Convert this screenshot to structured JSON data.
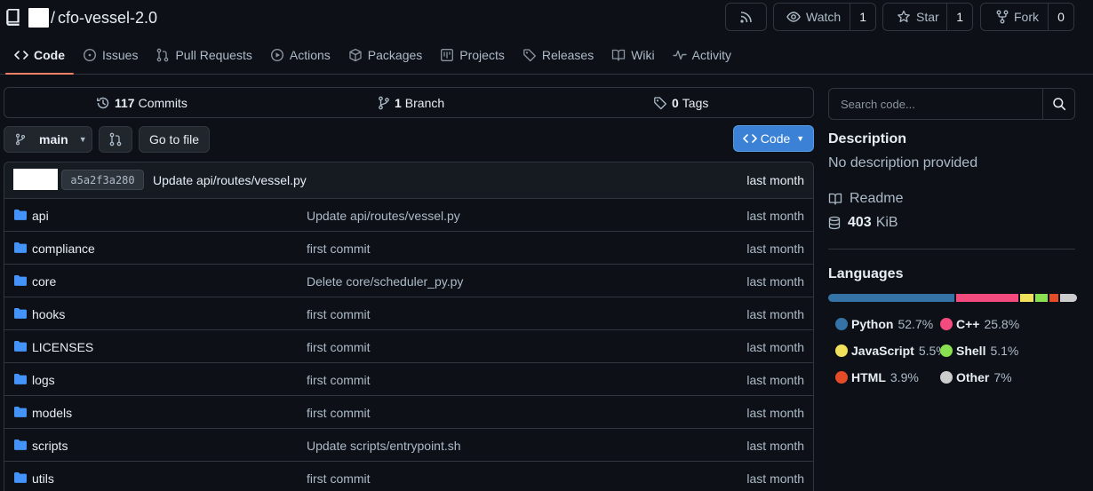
{
  "repo": {
    "separator": "/",
    "name": "cfo-vessel-2.0"
  },
  "header_actions": {
    "watch": {
      "label": "Watch",
      "count": "1"
    },
    "star": {
      "label": "Star",
      "count": "1"
    },
    "fork": {
      "label": "Fork",
      "count": "0"
    }
  },
  "tabs": [
    {
      "label": "Code",
      "icon": "code-icon",
      "active": true
    },
    {
      "label": "Issues",
      "icon": "issue-icon"
    },
    {
      "label": "Pull Requests",
      "icon": "pull-request-icon"
    },
    {
      "label": "Actions",
      "icon": "play-icon"
    },
    {
      "label": "Packages",
      "icon": "package-icon"
    },
    {
      "label": "Projects",
      "icon": "project-icon"
    },
    {
      "label": "Releases",
      "icon": "tag-icon"
    },
    {
      "label": "Wiki",
      "icon": "book-icon"
    },
    {
      "label": "Activity",
      "icon": "pulse-icon"
    }
  ],
  "stats": {
    "commits": {
      "count": "117",
      "label": "Commits"
    },
    "branches": {
      "count": "1",
      "label": "Branch"
    },
    "tags": {
      "count": "0",
      "label": "Tags"
    }
  },
  "toolbar": {
    "branch": "main",
    "goto_file": "Go to file",
    "code_button": "Code"
  },
  "latest_commit": {
    "sha": "a5a2f3a280",
    "message": "Update api/routes/vessel.py",
    "time": "last month"
  },
  "files": [
    {
      "name": "api",
      "message": "Update api/routes/vessel.py",
      "time": "last month"
    },
    {
      "name": "compliance",
      "message": "first commit",
      "time": "last month"
    },
    {
      "name": "core",
      "message": "Delete core/scheduler_py.py",
      "time": "last month"
    },
    {
      "name": "hooks",
      "message": "first commit",
      "time": "last month"
    },
    {
      "name": "LICENSES",
      "message": "first commit",
      "time": "last month"
    },
    {
      "name": "logs",
      "message": "first commit",
      "time": "last month"
    },
    {
      "name": "models",
      "message": "first commit",
      "time": "last month"
    },
    {
      "name": "scripts",
      "message": "Update scripts/entrypoint.sh",
      "time": "last month"
    },
    {
      "name": "utils",
      "message": "first commit",
      "time": "last month"
    }
  ],
  "sidebar": {
    "search_placeholder": "Search code...",
    "description_heading": "Description",
    "description_text": "No description provided",
    "readme_label": "Readme",
    "size_value": "403",
    "size_unit": "KiB",
    "languages_heading": "Languages"
  },
  "languages": [
    {
      "name": "Python",
      "percent": "52.7%",
      "value": 52.7,
      "color": "#3572a5"
    },
    {
      "name": "C++",
      "percent": "25.8%",
      "value": 25.8,
      "color": "#f34b7d"
    },
    {
      "name": "JavaScript",
      "percent": "5.5%",
      "value": 5.5,
      "color": "#f1e05a"
    },
    {
      "name": "Shell",
      "percent": "5.1%",
      "value": 5.1,
      "color": "#89e051"
    },
    {
      "name": "HTML",
      "percent": "3.9%",
      "value": 3.9,
      "color": "#e34c26"
    },
    {
      "name": "Other",
      "percent": "7%",
      "value": 7,
      "color": "#cccccc"
    }
  ]
}
